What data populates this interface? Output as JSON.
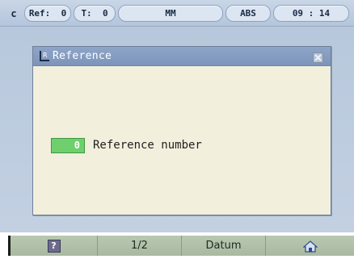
{
  "status_bar": {
    "mode_letter": "c",
    "ref": {
      "label": "Ref:",
      "value": "0"
    },
    "tool": {
      "label": "T:",
      "value": "0"
    },
    "units": "MM",
    "position_mode": "ABS",
    "clock": "09 : 14"
  },
  "dialog": {
    "title": "Reference",
    "icon": "reference-icon",
    "close_icon": "close-icon",
    "field_value": "0",
    "field_label": "Reference number"
  },
  "softkeys": {
    "help_label": "?",
    "page": "1/2",
    "datum": "Datum",
    "home_icon": "home-icon"
  },
  "colors": {
    "status_bar": "#b4c5dc",
    "dialog_title_bar": "#7d95bb",
    "dialog_body": "#f3efdd",
    "input_highlight": "#6fcf6d",
    "softkey_bar": "#a9b9a1"
  }
}
